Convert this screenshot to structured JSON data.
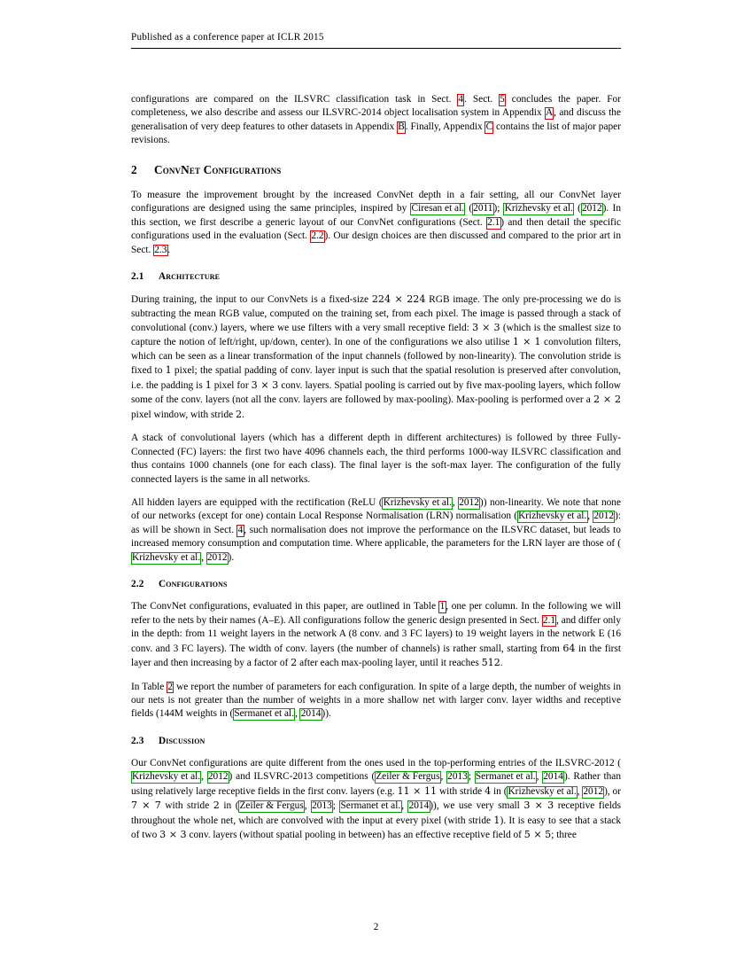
{
  "header": {
    "running_head": "Published as a conference paper at ICLR 2015"
  },
  "footer": {
    "page_number": "2"
  },
  "colors": {
    "citation_link_box": "#00a000",
    "internal_ref_box": "#e00000",
    "text": "#000000",
    "page_background": "#ffffff"
  },
  "intro_paragraph": {
    "t1": "configurations are compared on the ILSVRC classification task in Sect. ",
    "ref_sect4": "4",
    "t2": ". Sect. ",
    "ref_sect5": "5",
    "t3": " concludes the paper. For completeness, we also describe and assess our ILSVRC-2014 object localisation system in Appendix ",
    "ref_appA": "A",
    "t4": ", and discuss the generalisation of very deep features to other datasets in Appendix ",
    "ref_appB": "B",
    "t5": ". Finally, Appendix ",
    "ref_appC": "C",
    "t6": " contains the list of major paper revisions."
  },
  "section2": {
    "number": "2",
    "title": "ConvNet Configurations",
    "para1": {
      "t1": "To measure the improvement brought by the increased ConvNet depth in a fair setting, all our ConvNet layer configurations are designed using the same principles, inspired by ",
      "cite1_author": "Ciresan et al.",
      "t2": " (",
      "cite1_year": "2011",
      "t3": "); ",
      "cite2_author": "Krizhevsky et al.",
      "t4": " (",
      "cite2_year": "2012",
      "t5": "). In this section, we first describe a generic layout of our ConvNet configurations (Sect. ",
      "ref_21": "2.1",
      "t6": ") and then detail the specific configurations used in the evaluation (Sect. ",
      "ref_22": "2.2",
      "t7": "). Our design choices are then discussed and compared to the prior art in Sect. ",
      "ref_23": "2.3",
      "t8": "."
    }
  },
  "section21": {
    "number": "2.1",
    "title": "Architecture",
    "para1": {
      "t1": "During training, the input to our ConvNets is a fixed-size ",
      "m1": "224 × 224",
      "t2": " RGB image. The only pre-processing we do is subtracting the mean RGB value, computed on the training set, from each pixel. The image is passed through a stack of convolutional (conv.) layers, where we use filters with a very small receptive field: ",
      "m2": "3 × 3",
      "t3": " (which is the smallest size to capture the notion of left/right, up/down, center). In one of the configurations we also utilise ",
      "m3": "1 × 1",
      "t4": " convolution filters, which can be seen as a linear transformation of the input channels (followed by non-linearity). The convolution stride is fixed to ",
      "m4": "1",
      "t5": " pixel; the spatial padding of conv. layer input is such that the spatial resolution is preserved after convolution, i.e. the padding is ",
      "m5": "1",
      "t6": " pixel for ",
      "m6": "3 × 3",
      "t7": " conv. layers. Spatial pooling is carried out by five max-pooling layers, which follow some of the conv. layers (not all the conv. layers are followed by max-pooling). Max-pooling is performed over a ",
      "m7": "2 × 2",
      "t8": " pixel window, with stride ",
      "m8": "2",
      "t9": "."
    },
    "para2": {
      "t1": "A stack of convolutional layers (which has a different depth in different architectures) is followed by three Fully-Connected (FC) layers: the first two have 4096 channels each, the third performs 1000-way ILSVRC classification and thus contains 1000 channels (one for each class). The final layer is the soft-max layer. The configuration of the fully connected layers is the same in all networks."
    },
    "para3": {
      "t1": "All hidden layers are equipped with the rectification (ReLU (",
      "cite1_author": "Krizhevsky et al.",
      "t2": ", ",
      "cite1_year": "2012",
      "t3": ")) non-linearity. We note that none of our networks (except for one) contain Local Response Normalisation (LRN) normalisation (",
      "cite2_author": "Krizhevsky et al.",
      "t4": ", ",
      "cite2_year": "2012",
      "t5": "): as will be shown in Sect. ",
      "ref_sect4": "4",
      "t6": ", such normalisation does not improve the performance on the ILSVRC dataset, but leads to increased memory consumption and computation time. Where applicable, the parameters for the LRN layer are those of (",
      "cite3_author": "Krizhevsky et al.",
      "t7": ", ",
      "cite3_year": "2012",
      "t8": ")."
    }
  },
  "section22": {
    "number": "2.2",
    "title": "Configurations",
    "para1": {
      "t1": "The ConvNet configurations, evaluated in this paper, are outlined in Table ",
      "ref_table1": "1",
      "t2": ", one per column. In the following we will refer to the nets by their names (A–E). All configurations follow the generic design presented in Sect. ",
      "ref_21": "2.1",
      "t3": ", and differ only in the depth: from 11 weight layers in the network A (8 conv. and 3 FC layers) to 19 weight layers in the network E (16 conv. and 3 FC layers). The width of conv. layers (the number of channels) is rather small, starting from ",
      "m1": "64",
      "t4": " in the first layer and then increasing by a factor of ",
      "m2": "2",
      "t5": " after each max-pooling layer, until it reaches ",
      "m3": "512",
      "t6": "."
    },
    "para2": {
      "t1": "In Table ",
      "ref_table2": "2",
      "t2": " we report the number of parameters for each configuration. In spite of a large depth, the number of weights in our nets is not greater than the number of weights in a more shallow net with larger conv. layer widths and receptive fields (144M weights in (",
      "cite1_author": "Sermanet et al.",
      "t3": ", ",
      "cite1_year": "2014",
      "t4": "))."
    }
  },
  "section23": {
    "number": "2.3",
    "title": "Discussion",
    "para1": {
      "t1": "Our ConvNet configurations are quite different from the ones used in the top-performing entries of the ILSVRC-2012 (",
      "cite1_author": "Krizhevsky et al.",
      "t2": ", ",
      "cite1_year": "2012",
      "t3": ") and ILSVRC-2013 competitions (",
      "cite2_author": "Zeiler & Fergus",
      "t4": ", ",
      "cite2_year": "2013",
      "t5": "; ",
      "cite3_author": "Sermanet et al.",
      "t6": ", ",
      "cite3_year": "2014",
      "t7": "). Rather than using relatively large receptive fields in the first conv. layers (e.g. ",
      "m1": "11 × 11",
      "t8": " with stride ",
      "m2": "4",
      "t9": " in (",
      "cite4_author": "Krizhevsky et al.",
      "t10": ", ",
      "cite4_year": "2012",
      "t11": "), or ",
      "m3": "7 × 7",
      "t12": " with stride ",
      "m4": "2",
      "t13": " in (",
      "cite5_author": "Zeiler & Fergus",
      "t14": ", ",
      "cite5_year": "2013",
      "t15": "; ",
      "cite6_author": "Sermanet et al.",
      "t16": ", ",
      "cite6_year": "2014",
      "t17": ")), we use very small ",
      "m5": "3 × 3",
      "t18": " receptive fields throughout the whole net, which are convolved with the input at every pixel (with stride ",
      "m6": "1",
      "t19": "). It is easy to see that a stack of two ",
      "m7": "3 × 3",
      "t20": " conv. layers (without spatial pooling in between) has an effective receptive field of ",
      "m8": "5 × 5",
      "t21": "; three"
    }
  }
}
